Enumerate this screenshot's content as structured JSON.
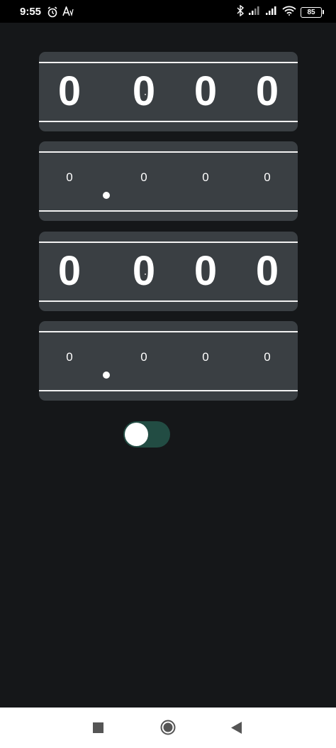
{
  "status_bar": {
    "time": "9:55",
    "battery_level": "85",
    "icons": [
      "alarm-icon",
      "font-size-icon",
      "bluetooth-icon",
      "signal-icon",
      "signal-icon",
      "wifi-icon",
      "battery-icon"
    ]
  },
  "counters": [
    {
      "style": "large",
      "digits": [
        "0",
        "0",
        "0",
        "0"
      ]
    },
    {
      "style": "small",
      "digits": [
        "0",
        "0",
        "0",
        "0"
      ]
    },
    {
      "style": "large",
      "digits": [
        "0",
        "0",
        "0",
        "0"
      ]
    },
    {
      "style": "small",
      "digits": [
        "0",
        "0",
        "0",
        "0"
      ]
    }
  ],
  "toggle": {
    "state": "off",
    "track_color": "#224c43",
    "knob_color": "#ffffff"
  },
  "nav_bar": {
    "buttons": [
      "recent-apps-icon",
      "home-icon",
      "back-icon"
    ]
  },
  "colors": {
    "background": "#151719",
    "panel": "#3a3f43",
    "text": "#ffffff"
  }
}
